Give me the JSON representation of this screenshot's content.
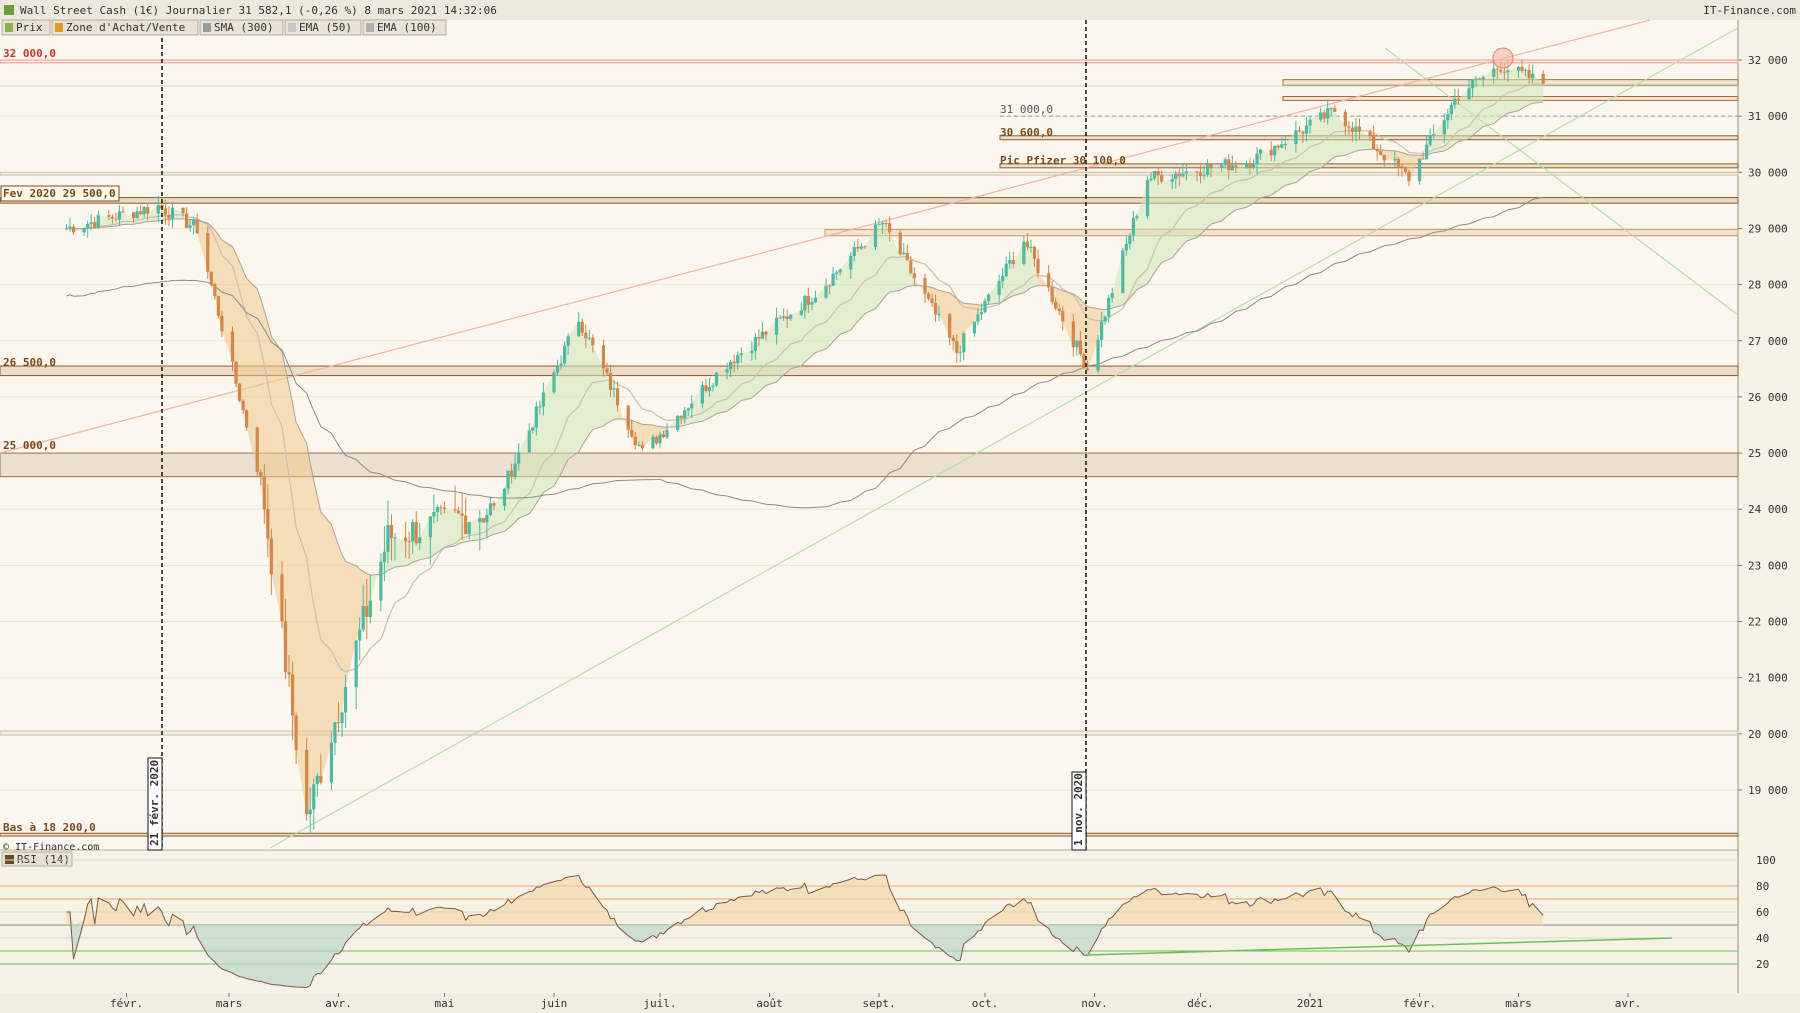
{
  "header": {
    "title": "Wall Street Cash (1€) Journalier 31 582,1 (-0,26 %) 8 mars 2021 14:32:06",
    "source": "IT-Finance.com"
  },
  "legend": [
    {
      "label": "Prix",
      "color": "#8fae4e"
    },
    {
      "label": "Zone d'Achat/Vente",
      "color": "#e39a2f"
    },
    {
      "label": "SMA (300)",
      "color": "#9a9a9a"
    },
    {
      "label": "EMA (50)",
      "color": "#c8c8c8"
    },
    {
      "label": "EMA (100)",
      "color": "#b0b0b0"
    }
  ],
  "annotations": {
    "level_32000": "32 000,0",
    "level_31000": "31 000,0",
    "level_30600": "30 600,0",
    "pic_pfizer": "Pic Pfizer 30 100,0",
    "fev_2020": "Fev 2020 29 500,0",
    "level_26500": "26 500,0",
    "level_25000": "25 000,0",
    "bas": "Bas à 18 200,0",
    "copyright": "© IT-Finance.com",
    "vline_1": "21 févr. 2020",
    "vline_2": "1 nov. 2020"
  },
  "rsi": {
    "label": "RSI (14)",
    "ticks": [
      "100",
      "80",
      "60",
      "40",
      "20"
    ]
  },
  "colors": {
    "bull": "#4fb8a0",
    "bear": "#d2874a",
    "ema_fill_green": "#cfe6b8",
    "ema_fill_orange": "#f0c98a",
    "resistance": "#a86a3a"
  },
  "chart_data": {
    "type": "candlestick",
    "x_ticks": [
      "févr.",
      "mars",
      "avr.",
      "mai",
      "juin",
      "juil.",
      "août",
      "sept.",
      "oct.",
      "nov.",
      "déc.",
      "2021",
      "févr.",
      "mars",
      "avr."
    ],
    "y_ticks": [
      "32 000",
      "31 000",
      "30 000",
      "29 000",
      "28 000",
      "27 000",
      "26 000",
      "25 000",
      "24 000",
      "23 000",
      "22 000",
      "21 000",
      "20 000",
      "19 000"
    ],
    "ylim": [
      18000,
      32500
    ],
    "key_levels": [
      32000,
      31600,
      31300,
      31000,
      30600,
      30100,
      30000,
      29500,
      29400,
      28900,
      26500,
      26400,
      25000,
      24600,
      18200
    ],
    "monthly_path": [
      {
        "date": "2020-01-15",
        "close": 29000
      },
      {
        "date": "2020-02-10",
        "close": 29400
      },
      {
        "date": "2020-02-21",
        "close": 29000
      },
      {
        "date": "2020-03-10",
        "close": 24500
      },
      {
        "date": "2020-03-23",
        "close": 18500
      },
      {
        "date": "2020-04-15",
        "close": 23500
      },
      {
        "date": "2020-05-15",
        "close": 24000
      },
      {
        "date": "2020-06-08",
        "close": 27400
      },
      {
        "date": "2020-06-26",
        "close": 25000
      },
      {
        "date": "2020-07-20",
        "close": 26600
      },
      {
        "date": "2020-08-15",
        "close": 27900
      },
      {
        "date": "2020-09-02",
        "close": 29100
      },
      {
        "date": "2020-09-23",
        "close": 26800
      },
      {
        "date": "2020-10-12",
        "close": 28800
      },
      {
        "date": "2020-10-30",
        "close": 26500
      },
      {
        "date": "2020-11-16",
        "close": 29900
      },
      {
        "date": "2020-12-15",
        "close": 30200
      },
      {
        "date": "2021-01-08",
        "close": 31100
      },
      {
        "date": "2021-01-29",
        "close": 29900
      },
      {
        "date": "2021-02-12",
        "close": 31400
      },
      {
        "date": "2021-02-24",
        "close": 31900
      },
      {
        "date": "2021-03-08",
        "close": 31582
      }
    ]
  }
}
